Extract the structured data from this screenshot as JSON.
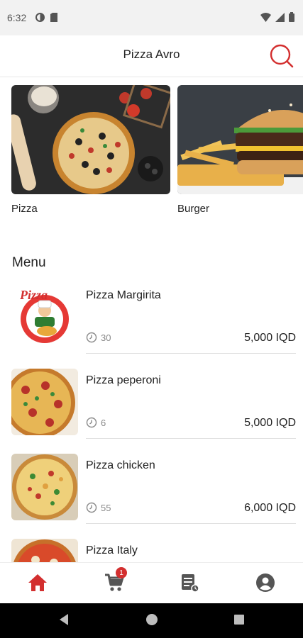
{
  "status_bar": {
    "time": "6:32",
    "icons": [
      "data-saver-icon",
      "sim-icon",
      "wifi-icon",
      "signal-icon",
      "battery-icon"
    ]
  },
  "app_bar": {
    "title": "Pizza Avro",
    "search_icon": "search-icon",
    "accent_color": "#d32f2f"
  },
  "categories": [
    {
      "label": "Pizza"
    },
    {
      "label": "Burger"
    }
  ],
  "menu": {
    "heading": "Menu",
    "items": [
      {
        "name": "Pizza Margirita",
        "time": "30",
        "price": "5,000 IQD"
      },
      {
        "name": "Pizza peperoni",
        "time": "6",
        "price": "5,000 IQD"
      },
      {
        "name": "Pizza chicken",
        "time": "55",
        "price": "6,000 IQD"
      },
      {
        "name": "Pizza Italy",
        "time": "",
        "price": ""
      }
    ]
  },
  "bottom_nav": {
    "items": [
      "home-icon",
      "cart-icon",
      "orders-icon",
      "profile-icon"
    ],
    "active": "home",
    "cart_badge": "1",
    "active_color": "#d32f2f",
    "inactive_color": "#555555"
  }
}
